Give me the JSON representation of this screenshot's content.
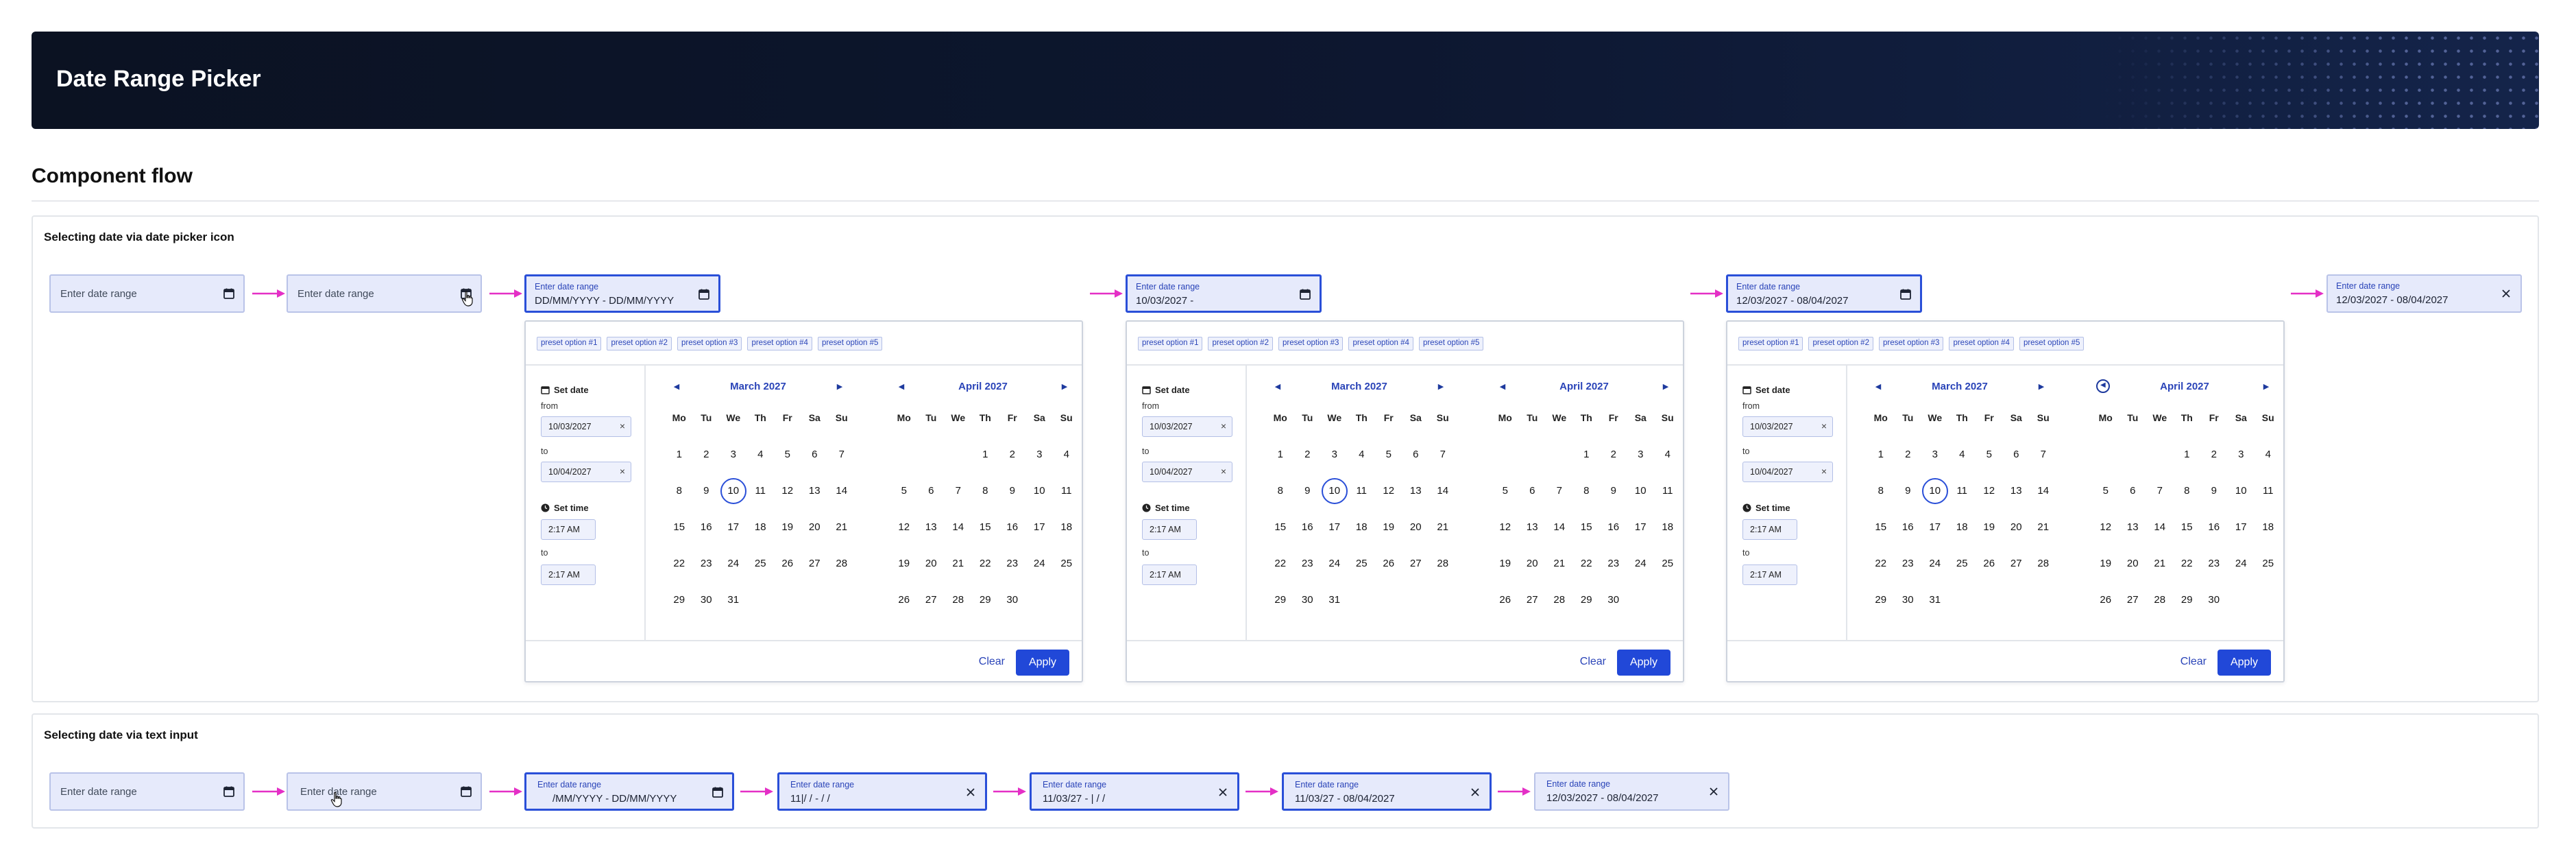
{
  "banner": {
    "title": "Date Range Picker"
  },
  "page_heading": "Component flow",
  "section1": {
    "title": "Selecting date via date picker icon"
  },
  "section2": {
    "title": "Selecting date via text input"
  },
  "field": {
    "placeholder": "Enter date range",
    "label": "Enter date range",
    "format_value": "DD/MM/YYYY - DD/MM/YYYY",
    "value_partial": "10/03/2027 -",
    "value_full": "12/03/2027 - 08/04/2027",
    "text_typing_1": "/MM/YYYY - DD/MM/YYYY",
    "text_typing_2": "11|/ / -  /  /",
    "text_typing_3": "11/03/27 - |  /  /",
    "text_typing_4": "11/03/27 - 08/04/2027",
    "text_final": "12/03/2027 - 08/04/2027"
  },
  "picker": {
    "presets": [
      "preset option #1",
      "preset option #2",
      "preset option #3",
      "preset option #4",
      "preset option #5"
    ],
    "set_date": "Set date",
    "from": "from",
    "to": "to",
    "from_value": "10/03/2027",
    "to_value": "10/04/2027",
    "set_time": "Set time",
    "time_from": "2:17 AM",
    "time_to": "2:17 AM",
    "clear": "Clear",
    "apply": "Apply",
    "weekdays": [
      "Mo",
      "Tu",
      "We",
      "Th",
      "Fr",
      "Sa",
      "Su"
    ],
    "march": {
      "name": "March 2027"
    },
    "april": {
      "name": "April 2027"
    }
  },
  "colors": {
    "accent": "#2148d8",
    "arrow": "#e42fc6",
    "field_bg": "#e6eafb"
  }
}
